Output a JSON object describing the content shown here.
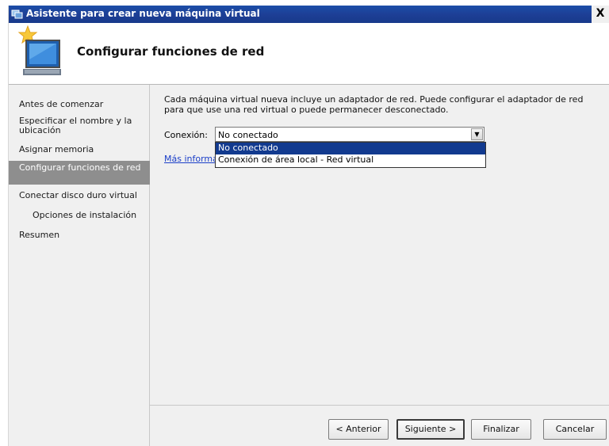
{
  "window": {
    "title": "Asistente para crear nueva máquina virtual",
    "close_label": "X"
  },
  "header": {
    "title": "Configurar funciones de red"
  },
  "sidebar": {
    "items": [
      {
        "label": "Antes de comenzar"
      },
      {
        "label": "Especificar el nombre y la ubicación"
      },
      {
        "label": "Asignar memoria"
      },
      {
        "label": "Configurar funciones de red",
        "active": true
      },
      {
        "label": "Conectar disco duro virtual"
      },
      {
        "label": "Opciones de instalación"
      },
      {
        "label": "Resumen"
      }
    ]
  },
  "main": {
    "description": "Cada máquina virtual nueva incluye un adaptador de red. Puede configurar el adaptador de red para que use una red virtual o puede permanecer desconectado.",
    "connection_label": "Conexión:",
    "connection_value": "No conectado",
    "dropdown_options": [
      {
        "label": "No conectado",
        "selected": true
      },
      {
        "label": "Conexión de área local - Red virtual",
        "selected": false
      }
    ],
    "more_info_link": "Más informa"
  },
  "footer": {
    "buttons": {
      "previous": "< Anterior",
      "next": "Siguiente >",
      "finish": "Finalizar",
      "cancel": "Cancelar"
    }
  },
  "colors": {
    "titlebar": "#1d3e95",
    "selection": "#123a8f",
    "sidebar_active": "#8e8e8e",
    "link": "#1a3ec8"
  },
  "icons": {
    "app": "virtual-machine-icon",
    "wizard": "monitor-star-icon",
    "dropdown": "chevron-down-icon"
  }
}
